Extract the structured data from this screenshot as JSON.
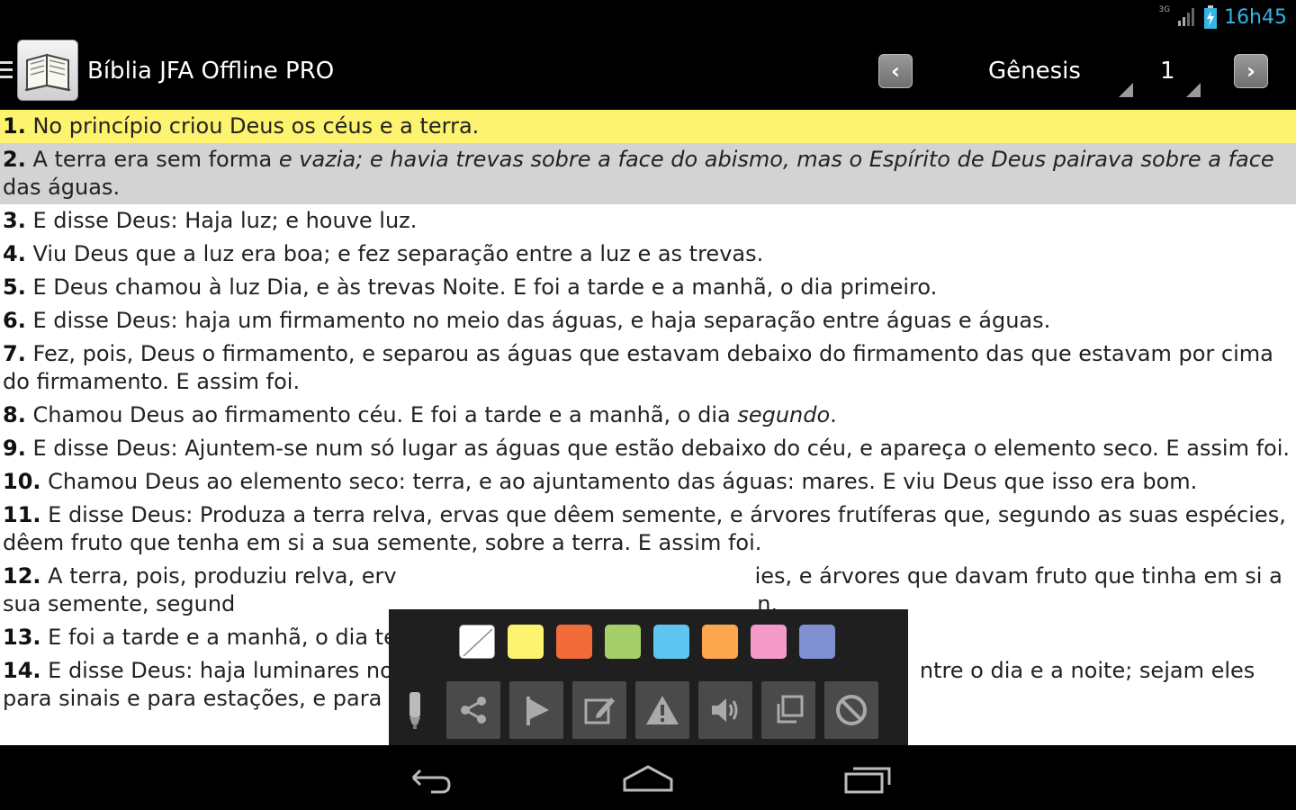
{
  "status_bar": {
    "network_label": "3G",
    "time": "16h45"
  },
  "header": {
    "app_title": "Bíblia JFA Offline PRO",
    "book": "Gênesis",
    "chapter": "1"
  },
  "verses": [
    {
      "num": "1.",
      "text": "No princípio criou Deus os céus e a terra.",
      "highlight": "#fdf36e"
    },
    {
      "num": "2.",
      "text_a": "A terra era sem forma ",
      "text_b": "e vazia; e havia trevas sobre a face do abismo, mas o Espírito de Deus pairava sobre a face",
      "text_c": "das águas.",
      "highlight": "#d3d3d3"
    },
    {
      "num": "3.",
      "text": "E disse Deus: Haja luz; e houve luz."
    },
    {
      "num": "4.",
      "text": "Viu Deus que a luz era boa; e fez separação entre a luz e as trevas."
    },
    {
      "num": "5.",
      "text": "E Deus chamou à luz Dia, e às trevas Noite. E foi a tarde e a manhã, o dia primeiro."
    },
    {
      "num": "6.",
      "text": "E disse Deus: haja um firmamento no meio das águas, e haja separação entre águas e águas."
    },
    {
      "num": "7.",
      "text": "Fez, pois, Deus o firmamento, e separou as águas que estavam debaixo do firmamento das que estavam por cima do firmamento. E assim foi."
    },
    {
      "num": "8.",
      "text_a": "Chamou Deus ao firmamento céu. E foi a tarde e a manhã, o dia ",
      "text_b": "segundo",
      "text_c": "."
    },
    {
      "num": "9.",
      "text": "E disse Deus: Ajuntem-se num só lugar as águas que estão debaixo do céu, e apareça o elemento seco. E assim foi."
    },
    {
      "num": "10.",
      "text": "Chamou Deus ao elemento seco: terra, e ao ajuntamento das águas: mares. E viu Deus que isso era bom."
    },
    {
      "num": "11.",
      "text": "E disse Deus: Produza a terra relva, ervas que dêem semente, e árvores frutíferas que, segundo as suas espécies, dêem fruto que tenha em si a sua semente, sobre a terra. E assim foi."
    },
    {
      "num": "12.",
      "text_a": "A terra, pois, produziu relva, erv",
      "text_b": "ies, e árvores que davam fruto que tinha em si a sua semente, segund",
      "text_c": "n."
    },
    {
      "num": "13.",
      "text": "E foi a tarde e a manhã, o dia ter"
    },
    {
      "num": "14.",
      "text_a": "E disse Deus: haja luminares no",
      "text_b": "ntre o dia e a noite; sejam eles para sinais e para estações, e para dias"
    }
  ],
  "highlight_colors": [
    "#ffffff",
    "#fdf36e",
    "#f26b3a",
    "#a6cf6b",
    "#5ec4f2",
    "#fda84e",
    "#f49ac8",
    "#7f8fd0"
  ],
  "toolbar_actions": [
    {
      "name": "share-icon"
    },
    {
      "name": "bookmark-flag-icon"
    },
    {
      "name": "edit-note-icon"
    },
    {
      "name": "warning-icon"
    },
    {
      "name": "speaker-icon"
    },
    {
      "name": "copy-icon"
    },
    {
      "name": "block-icon"
    }
  ],
  "colors": {
    "accent": "#33b5e5",
    "toolbar_bg": "#1f1f1f",
    "button_bg": "#4a4a4a"
  }
}
